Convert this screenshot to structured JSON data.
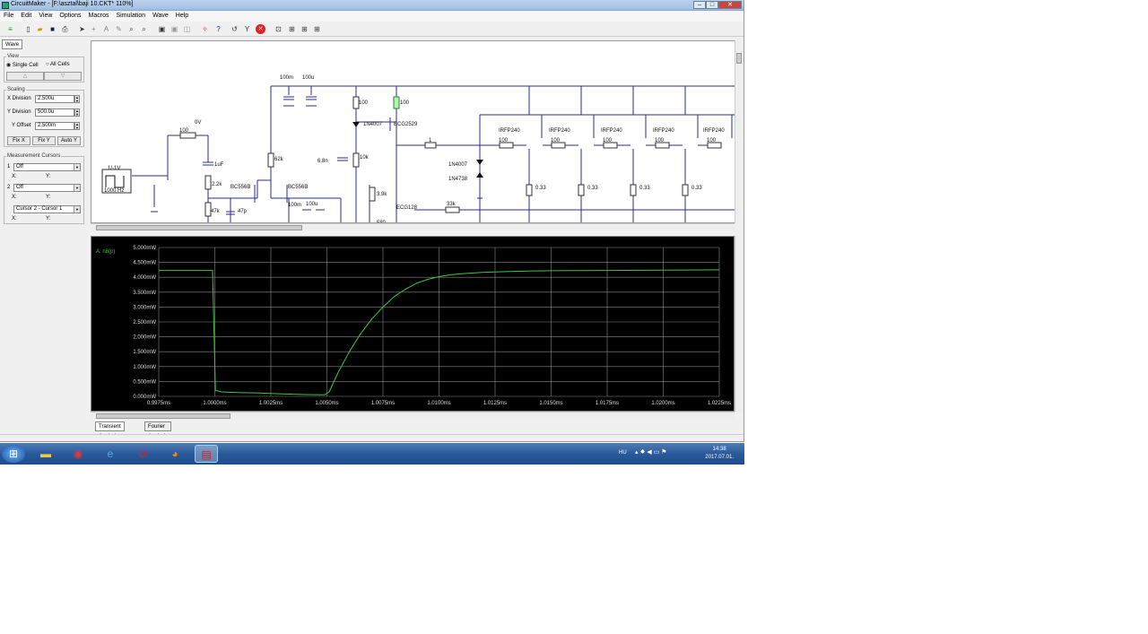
{
  "window": {
    "title": "CircuitMaker - [F:\\asztal\\baji 10.CKT* 110%]"
  },
  "menu": [
    "File",
    "Edit",
    "View",
    "Options",
    "Macros",
    "Simulation",
    "Wave",
    "Help"
  ],
  "panel": {
    "tab": "Wave",
    "view_label": "View",
    "single_cell": "Single Cell",
    "all_cells": "All Cells",
    "scaling_label": "Scaling",
    "x_division_label": "X Division",
    "x_division": "2.500u",
    "y_division_label": "Y Division",
    "y_division": "500.0u",
    "y_offset_label": "Y Offset",
    "y_offset": "2.500m",
    "fix_x": "Fix X",
    "fix_y": "Fix Y",
    "auto_y": "Auto Y",
    "cursors_label": "Measurement Cursors",
    "cursor1_num": "1",
    "cursor1_value": "Off",
    "cursor2_num": "2",
    "cursor2_value": "Off",
    "x_label": "X:",
    "y_label": "Y:",
    "cursor_diff": "Cursor 2 - Cursor 1"
  },
  "schematic": {
    "labels": {
      "c100m": "100m",
      "c100u": "100u",
      "r100a": "100",
      "r100b": "100",
      "d1n4007a": "1N4007",
      "ecg2529": "ECG2529",
      "zero_v": "0V",
      "r100c": "100",
      "c1uf": "1uF",
      "source": "1/-1V",
      "freq": "1000 Hz",
      "r2k2": "2.2k",
      "bc556a": "BC556B",
      "bc556b": "BC556B",
      "r62k": "62k",
      "c6n8": "6.8n",
      "r10k": "10k",
      "r3k9": "3.9k",
      "ecg128": "ECG128",
      "r580": "580",
      "r47k": "47k",
      "c47p": "47p",
      "c100m2": "100m",
      "c100u2": "100u",
      "r1": "1",
      "d1n4007b": "1N4007",
      "d1n4738": "1N4738",
      "r33k": "33k",
      "irfp1": "IRFP240",
      "irfp2": "IRFP240",
      "irfp3": "IRFP240",
      "irfp4": "IRFP240",
      "irfp5": "IRFP240",
      "g1": "100",
      "g2": "100",
      "g3": "100",
      "g4": "100",
      "g5": "100",
      "rs1": "0.33",
      "rs2": "0.33",
      "rs3": "0.33",
      "rs4": "0.33"
    }
  },
  "chart_data": {
    "type": "line",
    "title": "",
    "trace_label": "A: n8(p)",
    "xlabel": "",
    "ylabel": "",
    "xlim": [
      0.9975,
      1.0225
    ],
    "ylim": [
      0,
      5.0
    ],
    "x_ticks": [
      "0.9975ms",
      "1.0000ms",
      "1.0025ms",
      "1.0050ms",
      "1.0075ms",
      "1.0100ms",
      "1.0125ms",
      "1.0150ms",
      "1.0175ms",
      "1.0200ms",
      "1.0225ms"
    ],
    "y_ticks": [
      "5.000mW",
      "4.500mW",
      "4.000mW",
      "3.500mW",
      "3.000mW",
      "2.500mW",
      "2.000mW",
      "1.500mW",
      "1.000mW",
      "0.500mW",
      "0.000mW"
    ],
    "grid": true,
    "series": [
      {
        "color": "#3cc83c",
        "x": [
          0.9975,
          0.9999,
          1.00003,
          1.0003,
          1.001,
          1.002,
          1.003,
          1.004,
          1.0049,
          1.0051,
          1.0055,
          1.006,
          1.0065,
          1.007,
          1.0075,
          1.008,
          1.0085,
          1.009,
          1.0095,
          1.01,
          1.0105,
          1.011,
          1.012,
          1.013,
          1.014,
          1.015,
          1.0175,
          1.02,
          1.0225
        ],
        "y": [
          4.23,
          4.23,
          0.2,
          0.15,
          0.13,
          0.11,
          0.08,
          0.06,
          0.05,
          0.15,
          0.8,
          1.5,
          2.1,
          2.6,
          3.0,
          3.35,
          3.6,
          3.8,
          3.93,
          4.02,
          4.08,
          4.12,
          4.17,
          4.19,
          4.21,
          4.22,
          4.23,
          4.24,
          4.25
        ]
      }
    ]
  },
  "tabs": [
    "Transient Analysis",
    "Fourier Analysis"
  ],
  "taskbar": {
    "lang": "HU",
    "time": "14:38",
    "date": "2017.07.01."
  },
  "colors": {
    "wire": "#2b2b8c",
    "trace": "#3cc83c",
    "grid": "#8a8a8a",
    "axis_text": "#dcdcdc"
  }
}
